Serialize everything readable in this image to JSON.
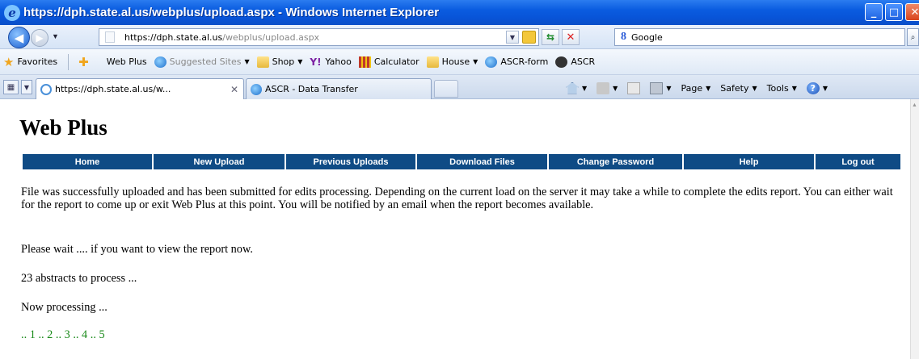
{
  "window": {
    "title": "https://dph.state.al.us/webplus/upload.aspx - Windows Internet Explorer"
  },
  "address_bar": {
    "url_host": "https://dph.state.al.us",
    "url_path": "/webplus/upload.aspx",
    "search_engine": "Google"
  },
  "favorites_bar": {
    "favorites_label": "Favorites",
    "links": [
      "Web Plus",
      "Suggested Sites",
      "Shop",
      "Yahoo",
      "Calculator",
      "House",
      "ASCR-form",
      "ASCR"
    ]
  },
  "tabs": [
    {
      "label": "https://dph.state.al.us/w...",
      "active": true
    },
    {
      "label": "ASCR - Data Transfer",
      "active": false
    }
  ],
  "command_bar": {
    "page": "Page",
    "safety": "Safety",
    "tools": "Tools"
  },
  "page": {
    "site_title": "Web Plus",
    "nav": [
      "Home",
      "New Upload",
      "Previous Uploads",
      "Download Files",
      "Change Password",
      "Help",
      "Log out"
    ],
    "message": "File was successfully uploaded and has been submitted for edits processing. Depending on the current load on the server it may take a while to complete the edits report. You can either wait for the report to come up or exit Web Plus at this point. You will be notified by an email when the report becomes available.",
    "wait_text": "Please wait .... if you want to view the report now.",
    "abstracts_text": "23 abstracts to process ...",
    "processing_text": "Now processing ...",
    "progress_text": ".. 1 .. 2 .. 3 .. 4 .. 5"
  },
  "colors": {
    "nav_bar": "#0f4b85",
    "progress_text": "#1a8a1a",
    "titlebar": "#0a5ce0"
  }
}
